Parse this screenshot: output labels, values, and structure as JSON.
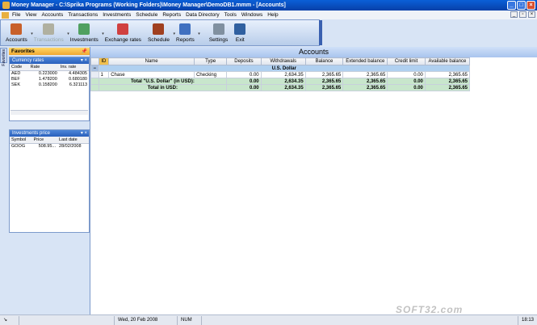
{
  "window": {
    "title": "Money Manager - C:\\Sprika Programs (Working Folders)\\Money Manager\\DemoDB1.mmm - [Accounts]"
  },
  "menu": [
    "File",
    "View",
    "Accounts",
    "Transactions",
    "Investments",
    "Schedule",
    "Reports",
    "Data Directory",
    "Tools",
    "Windows",
    "Help"
  ],
  "toolbar": [
    {
      "label": "Accounts",
      "icon": "accounts-icon",
      "color": "#c8602a",
      "disabled": false,
      "arrow": true
    },
    {
      "label": "Transactions",
      "icon": "transactions-icon",
      "color": "#b0b0a0",
      "disabled": true,
      "arrow": true
    },
    {
      "label": "Investments",
      "icon": "investments-icon",
      "color": "#50a060",
      "disabled": false,
      "arrow": true
    },
    {
      "label": "Exchange rates",
      "icon": "exchange-rates-icon",
      "color": "#d04040",
      "disabled": false,
      "arrow": false
    },
    {
      "label": "Schedule",
      "icon": "schedule-icon",
      "color": "#a04020",
      "disabled": false,
      "arrow": true
    },
    {
      "label": "Reports",
      "icon": "reports-icon",
      "color": "#4070c0",
      "disabled": false,
      "arrow": true
    },
    {
      "label": "Settings",
      "icon": "settings-icon",
      "color": "#8090a0",
      "disabled": false,
      "arrow": false
    },
    {
      "label": "Exit",
      "icon": "exit-icon",
      "color": "#3060a0",
      "disabled": false,
      "arrow": false
    }
  ],
  "sidetab": {
    "label": "Favorites"
  },
  "favorites": {
    "title": "Favorites",
    "currency": {
      "title": "Currency rates",
      "columns": [
        "Code",
        "Rate",
        "Inv. rate"
      ],
      "rows": [
        [
          "AED",
          "0.223000",
          "4.484305"
        ],
        [
          "BEF",
          "1.478200",
          "0.680180"
        ],
        [
          "SEK",
          "0.158200",
          "6.321113"
        ]
      ]
    },
    "investments": {
      "title": "Investments price",
      "columns": [
        "Symbol",
        "Price",
        "Last date"
      ],
      "rows": [
        [
          "GOOG",
          "508.95...",
          "28/02/2008"
        ]
      ]
    }
  },
  "accounts": {
    "title": "Accounts",
    "columns": [
      "ID",
      "Name",
      "Type",
      "Deposits",
      "Withdrawals",
      "Balance",
      "Extended balance",
      "Credit limit",
      "Available balance"
    ],
    "group": "U.S. Dollar",
    "rows": [
      [
        "1",
        "Chase",
        "Checking",
        "0.00",
        "2,634.35",
        "2,365.65",
        "2,365.65",
        "0.00",
        "2,365.65"
      ]
    ],
    "totals": [
      {
        "label": "Total \"U.S. Dollar\" (in USD):",
        "values": [
          "0.00",
          "2,634.35",
          "2,365.65",
          "2,365.65",
          "0.00",
          "2,365.65"
        ]
      },
      {
        "label": "Total in USD:",
        "values": [
          "0.00",
          "2,634.35",
          "2,365.65",
          "2,365.65",
          "0.00",
          "2,365.65"
        ]
      }
    ]
  },
  "status": {
    "date": "Wed, 20 Feb 2008",
    "num": "NUM",
    "time": "18:13"
  },
  "watermark": "SOFT32.com"
}
